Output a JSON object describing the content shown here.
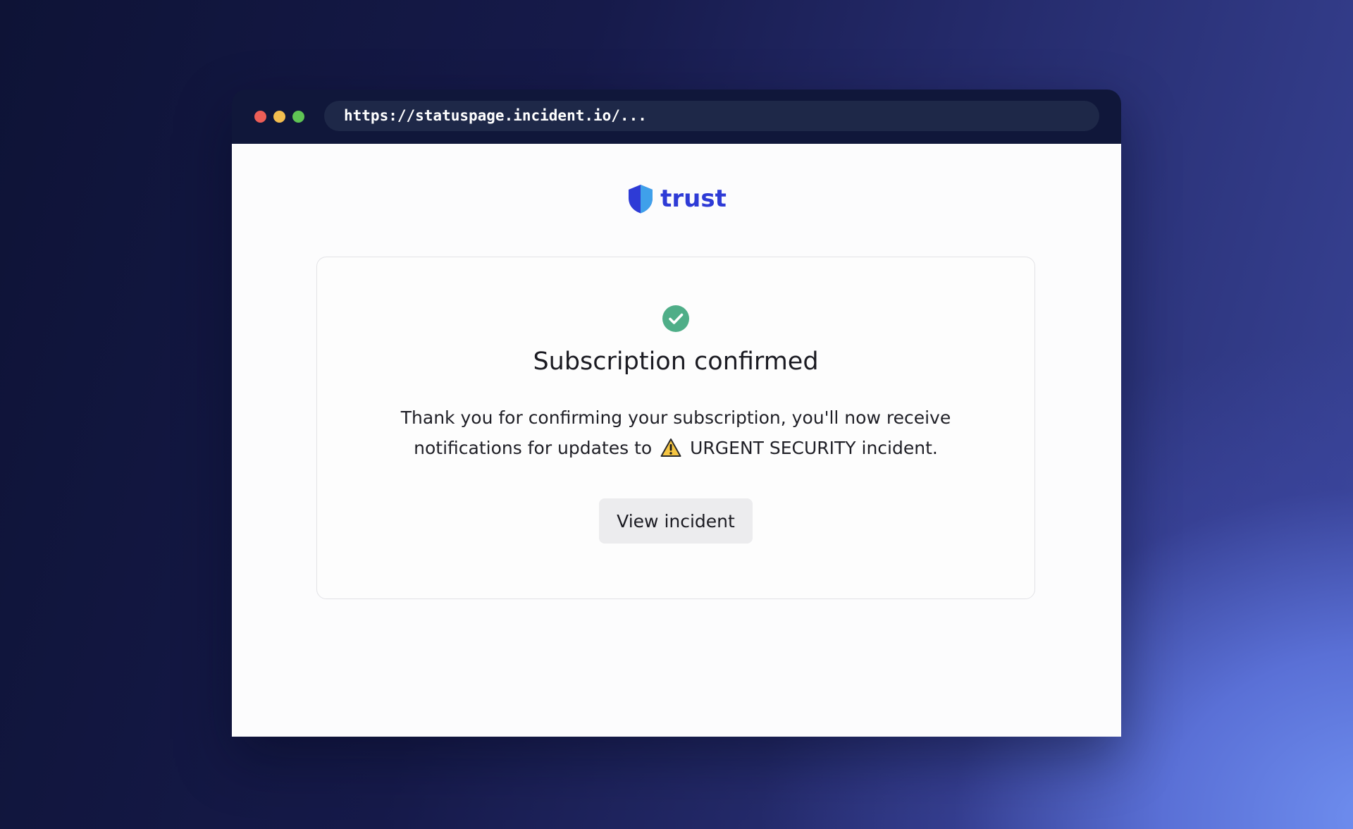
{
  "browser": {
    "url": "https://statuspage.incident.io/..."
  },
  "brand": {
    "name": "TRUST",
    "color": "#2e3bd6",
    "icon": "shield-icon"
  },
  "confirmation": {
    "status_icon": "check-circle-icon",
    "status_color": "#4fae88",
    "title": "Subscription confirmed",
    "message_part1": "Thank you for confirming your subscription, you'll now receive notifications for updates to",
    "incident_icon": "warning-icon",
    "message_part2": "URGENT SECURITY incident.",
    "button_label": "View incident"
  }
}
